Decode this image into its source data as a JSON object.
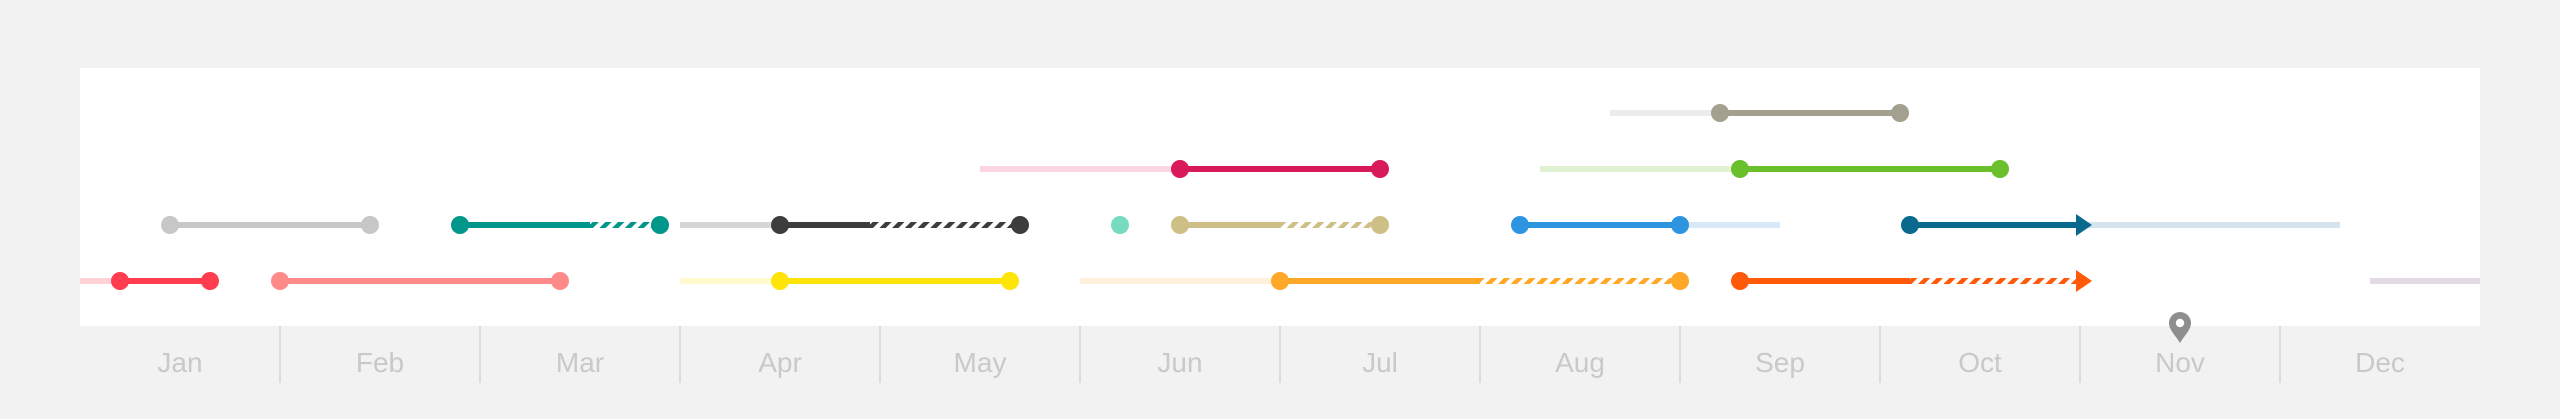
{
  "chart_data": {
    "type": "timeline",
    "months": [
      "Jan",
      "Feb",
      "Mar",
      "Apr",
      "May",
      "Jun",
      "Jul",
      "Aug",
      "Sep",
      "Oct",
      "Nov",
      "Dec"
    ],
    "today_marker": {
      "month": "Nov",
      "icon": "location-pin-icon",
      "color": "#8e8e8e"
    },
    "tracks": [
      {
        "lane": 1,
        "color": "#ff3d4f",
        "faded": "#ffd2d6",
        "context": [
          0.0,
          0.27
        ],
        "solid": [
          0.2,
          0.65
        ],
        "start_marker": "dot",
        "end_marker": "dot"
      },
      {
        "lane": 1,
        "color": "#ff8a8a",
        "faded": "#ffe0e0",
        "solid": [
          1.0,
          2.4
        ],
        "start_marker": "dot",
        "end_marker": "dot"
      },
      {
        "lane": 1,
        "color": "#ffe40a",
        "faded": "#fffbcf",
        "context": [
          3.0,
          3.5
        ],
        "solid": [
          3.5,
          4.65
        ],
        "start_marker": "dot",
        "end_marker": "dot"
      },
      {
        "lane": 1,
        "color": "#ffa727",
        "faded": "#fff0dc",
        "context": [
          5.0,
          6.0
        ],
        "solid": [
          6.0,
          7.0
        ],
        "hatched": [
          7.0,
          8.0
        ],
        "start_marker": "dot",
        "end_marker": "dot"
      },
      {
        "lane": 1,
        "color": "#ff5a0a",
        "solid": [
          8.3,
          9.15
        ],
        "hatched": [
          9.15,
          10.0
        ],
        "start_marker": "dot",
        "end_marker": "arrow"
      },
      {
        "lane": 1,
        "color": "#e2dbe6",
        "faded": "#e2dbe6",
        "context": [
          11.45,
          12.0
        ]
      },
      {
        "lane": 2,
        "color": "#c7c7c7",
        "solid": [
          0.45,
          1.45
        ],
        "start_marker": "dot",
        "end_marker": "dot"
      },
      {
        "lane": 2,
        "color": "#00968a",
        "solid": [
          1.9,
          2.55
        ],
        "hatched": [
          2.55,
          2.9
        ],
        "start_marker": "dot",
        "end_marker": "dot"
      },
      {
        "lane": 2,
        "color": "#3d3d3d",
        "faded": "#d6d6d6",
        "context": [
          3.0,
          3.5
        ],
        "solid": [
          3.5,
          3.95
        ],
        "hatched": [
          3.95,
          4.7
        ],
        "start_marker": "dot",
        "end_marker": "dot"
      },
      {
        "lane": 2,
        "color": "#76dcbd",
        "point": 5.2
      },
      {
        "lane": 2,
        "color": "#cebf87",
        "solid": [
          5.5,
          6.0
        ],
        "hatched": [
          6.0,
          6.5
        ],
        "start_marker": "dot",
        "end_marker": "dot"
      },
      {
        "lane": 2,
        "color": "#2d95df",
        "faded": "#d7e9f8",
        "solid": [
          7.2,
          8.0
        ],
        "context": [
          8.0,
          8.5
        ],
        "start_marker": "dot",
        "end_marker": "dot"
      },
      {
        "lane": 2,
        "color": "#0a6a8e",
        "faded": "#d4e3ee",
        "solid": [
          9.15,
          10.0
        ],
        "context": [
          10.0,
          11.3
        ],
        "start_marker": "dot",
        "end_marker": "arrow"
      },
      {
        "lane": 3,
        "color": "#d81a5a",
        "faded": "#fbd5e0",
        "context": [
          4.5,
          5.5
        ],
        "solid": [
          5.5,
          6.5
        ],
        "start_marker": "dot",
        "end_marker": "dot"
      },
      {
        "lane": 3,
        "color": "#6abf2d",
        "faded": "#e0f2d2",
        "context": [
          7.3,
          8.3
        ],
        "solid": [
          8.3,
          9.6
        ],
        "start_marker": "dot",
        "end_marker": "dot"
      },
      {
        "lane": 4,
        "color": "#a3a08f",
        "faded": "#ececea",
        "context": [
          7.65,
          8.2
        ],
        "solid": [
          8.2,
          9.1
        ],
        "start_marker": "dot",
        "end_marker": "dot"
      }
    ]
  }
}
